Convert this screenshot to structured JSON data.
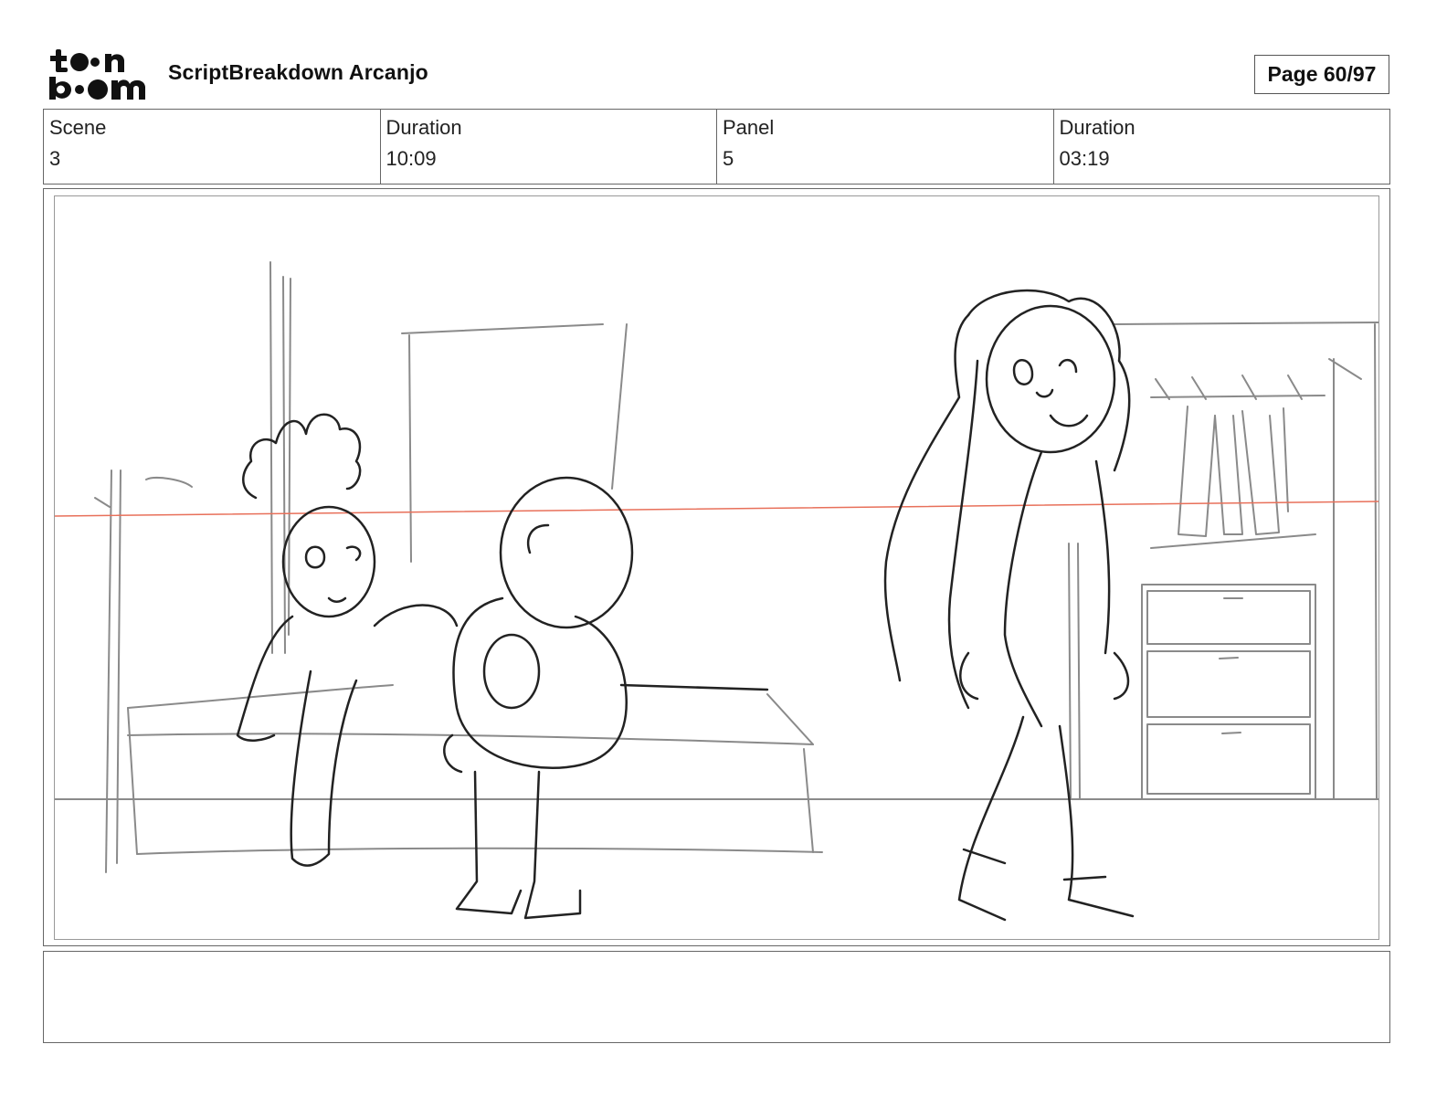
{
  "header": {
    "title": "ScriptBreakdown Arcanjo",
    "page_label": "Page 60/97",
    "logo_text": "toonboom"
  },
  "info": [
    {
      "label": "Scene",
      "value": "3"
    },
    {
      "label": "Duration",
      "value": "10:09"
    },
    {
      "label": "Panel",
      "value": "5"
    },
    {
      "label": "Duration",
      "value": "03:19"
    }
  ],
  "panel": {
    "guide_line_color": "#e8705a",
    "sketch_color": "#222222",
    "background_sketch_color": "#8a8a8a"
  },
  "notes": {
    "text": ""
  }
}
